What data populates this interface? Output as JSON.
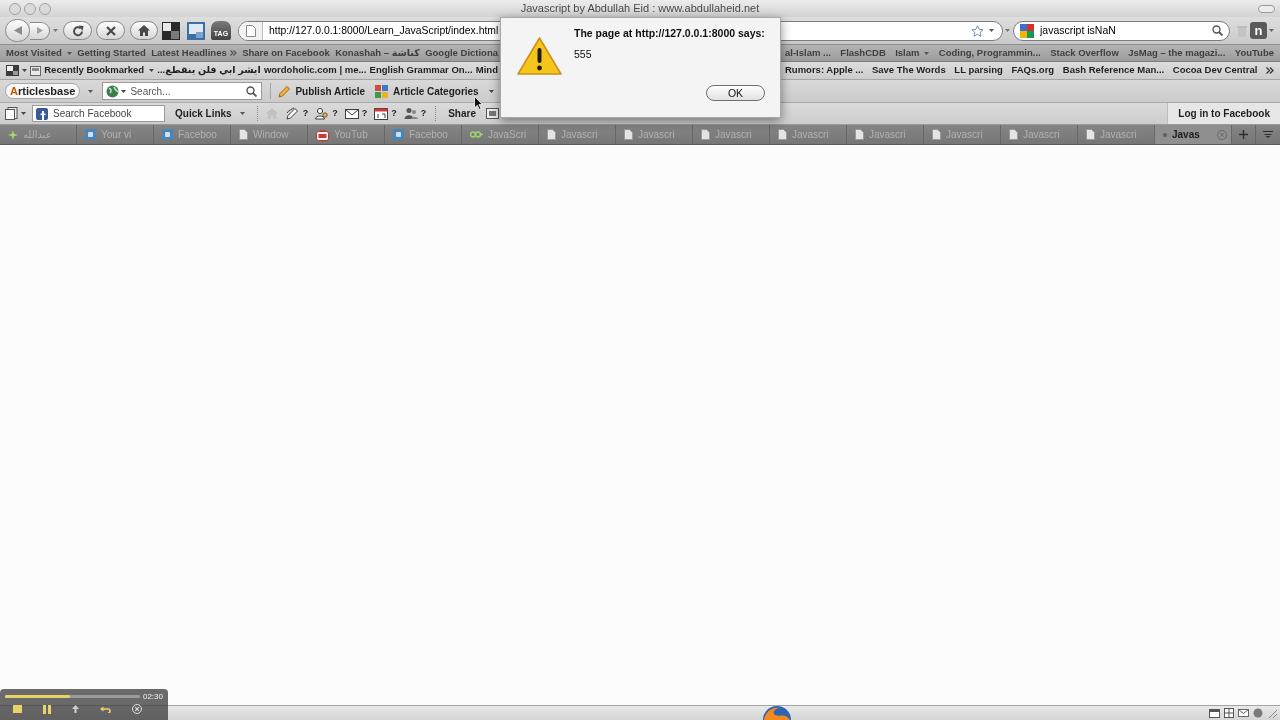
{
  "window": {
    "title": "Javascript by Abdullah Eid : www.abdullaheid.net"
  },
  "navigation": {
    "tag_label": "TAG",
    "url": "http://127.0.0.1:8000/Learn_JavaScript/index.html",
    "search": "javascript isNaN",
    "addon_label": "n"
  },
  "bookmarks_bar": {
    "left": [
      {
        "label": "Most Visited",
        "kind": "folder"
      },
      {
        "label": "Getting Started",
        "kind": "link"
      },
      {
        "label": "Latest Headlines",
        "kind": "feed"
      },
      {
        "label": "Share on Facebook",
        "kind": "link"
      },
      {
        "label": "Konashah – كناشة",
        "kind": "link"
      },
      {
        "label": "Google Dictiona",
        "kind": "link"
      }
    ],
    "right": [
      {
        "label": "al-Islam ...",
        "kind": "link"
      },
      {
        "label": "FlashCDB",
        "kind": "link"
      },
      {
        "label": "Islam",
        "kind": "folder"
      },
      {
        "label": "Coding, Programmin...",
        "kind": "link"
      },
      {
        "label": "Stack Overflow",
        "kind": "link"
      },
      {
        "label": "JsMag – the magazi...",
        "kind": "link"
      },
      {
        "label": "YouTube",
        "kind": "link"
      }
    ]
  },
  "recent_bar": {
    "left": [
      {
        "label": "Recently Bookmarked",
        "kind": "menu"
      },
      {
        "label": "ايشر ابي فلن ينقطع...",
        "kind": "link"
      },
      {
        "label": "wordoholic.com | me...",
        "kind": "link"
      },
      {
        "label": "English Grammar On...",
        "kind": "link"
      },
      {
        "label": "Mind",
        "kind": "link"
      }
    ],
    "right": [
      {
        "label": "Rumors: Apple ...",
        "kind": "link"
      },
      {
        "label": "Save The Words",
        "kind": "link"
      },
      {
        "label": "LL parsing",
        "kind": "link"
      },
      {
        "label": "FAQs.org",
        "kind": "link"
      },
      {
        "label": "Bash Reference Man...",
        "kind": "link"
      },
      {
        "label": "Cocoa Dev Central",
        "kind": "link"
      }
    ]
  },
  "articles_toolbar": {
    "logo": "Articlesbase",
    "search_placeholder": "Search...",
    "buttons": [
      {
        "label": "Publish Article",
        "kind": "publish"
      },
      {
        "label": "Article Categories",
        "kind": "categories"
      }
    ]
  },
  "facebook_toolbar": {
    "search_placeholder": "Search Facebook",
    "quick_links": "Quick Links",
    "notifications": [
      {
        "kind": "pencil",
        "count": "?"
      },
      {
        "kind": "people",
        "count": "?"
      },
      {
        "kind": "mail",
        "count": "?"
      },
      {
        "kind": "calendar",
        "count": "?"
      },
      {
        "kind": "person",
        "count": "?"
      }
    ],
    "share": "Share",
    "login": "Log in to Facebook"
  },
  "tabs": [
    {
      "title": "عبدالله",
      "kind": "sparkle",
      "selected": false
    },
    {
      "title": "Your vi",
      "kind": "badge",
      "selected": false
    },
    {
      "title": "Faceboo",
      "kind": "badge",
      "selected": false
    },
    {
      "title": "Window",
      "kind": "page",
      "selected": false
    },
    {
      "title": "YouTub",
      "kind": "tv",
      "selected": false
    },
    {
      "title": "Faceboo",
      "kind": "badge",
      "selected": false
    },
    {
      "title": "JavaScri",
      "kind": "chain",
      "selected": false
    },
    {
      "title": "Javascri",
      "kind": "page",
      "selected": false
    },
    {
      "title": "Javascri",
      "kind": "page",
      "selected": false
    },
    {
      "title": "Javascri",
      "kind": "page",
      "selected": false
    },
    {
      "title": "Javascri",
      "kind": "page",
      "selected": false
    },
    {
      "title": "Javascri",
      "kind": "page",
      "selected": false
    },
    {
      "title": "Javascri",
      "kind": "page",
      "selected": false
    },
    {
      "title": "Javascri",
      "kind": "page",
      "selected": false
    },
    {
      "title": "Javascri",
      "kind": "page",
      "selected": false
    },
    {
      "title": "Javas",
      "kind": "dot",
      "selected": true
    }
  ],
  "dialog": {
    "message": "The page at http://127.0.0.1:8000 says:",
    "text": "555",
    "button": "OK"
  },
  "player": {
    "level": 0.48,
    "time": "02:30"
  }
}
